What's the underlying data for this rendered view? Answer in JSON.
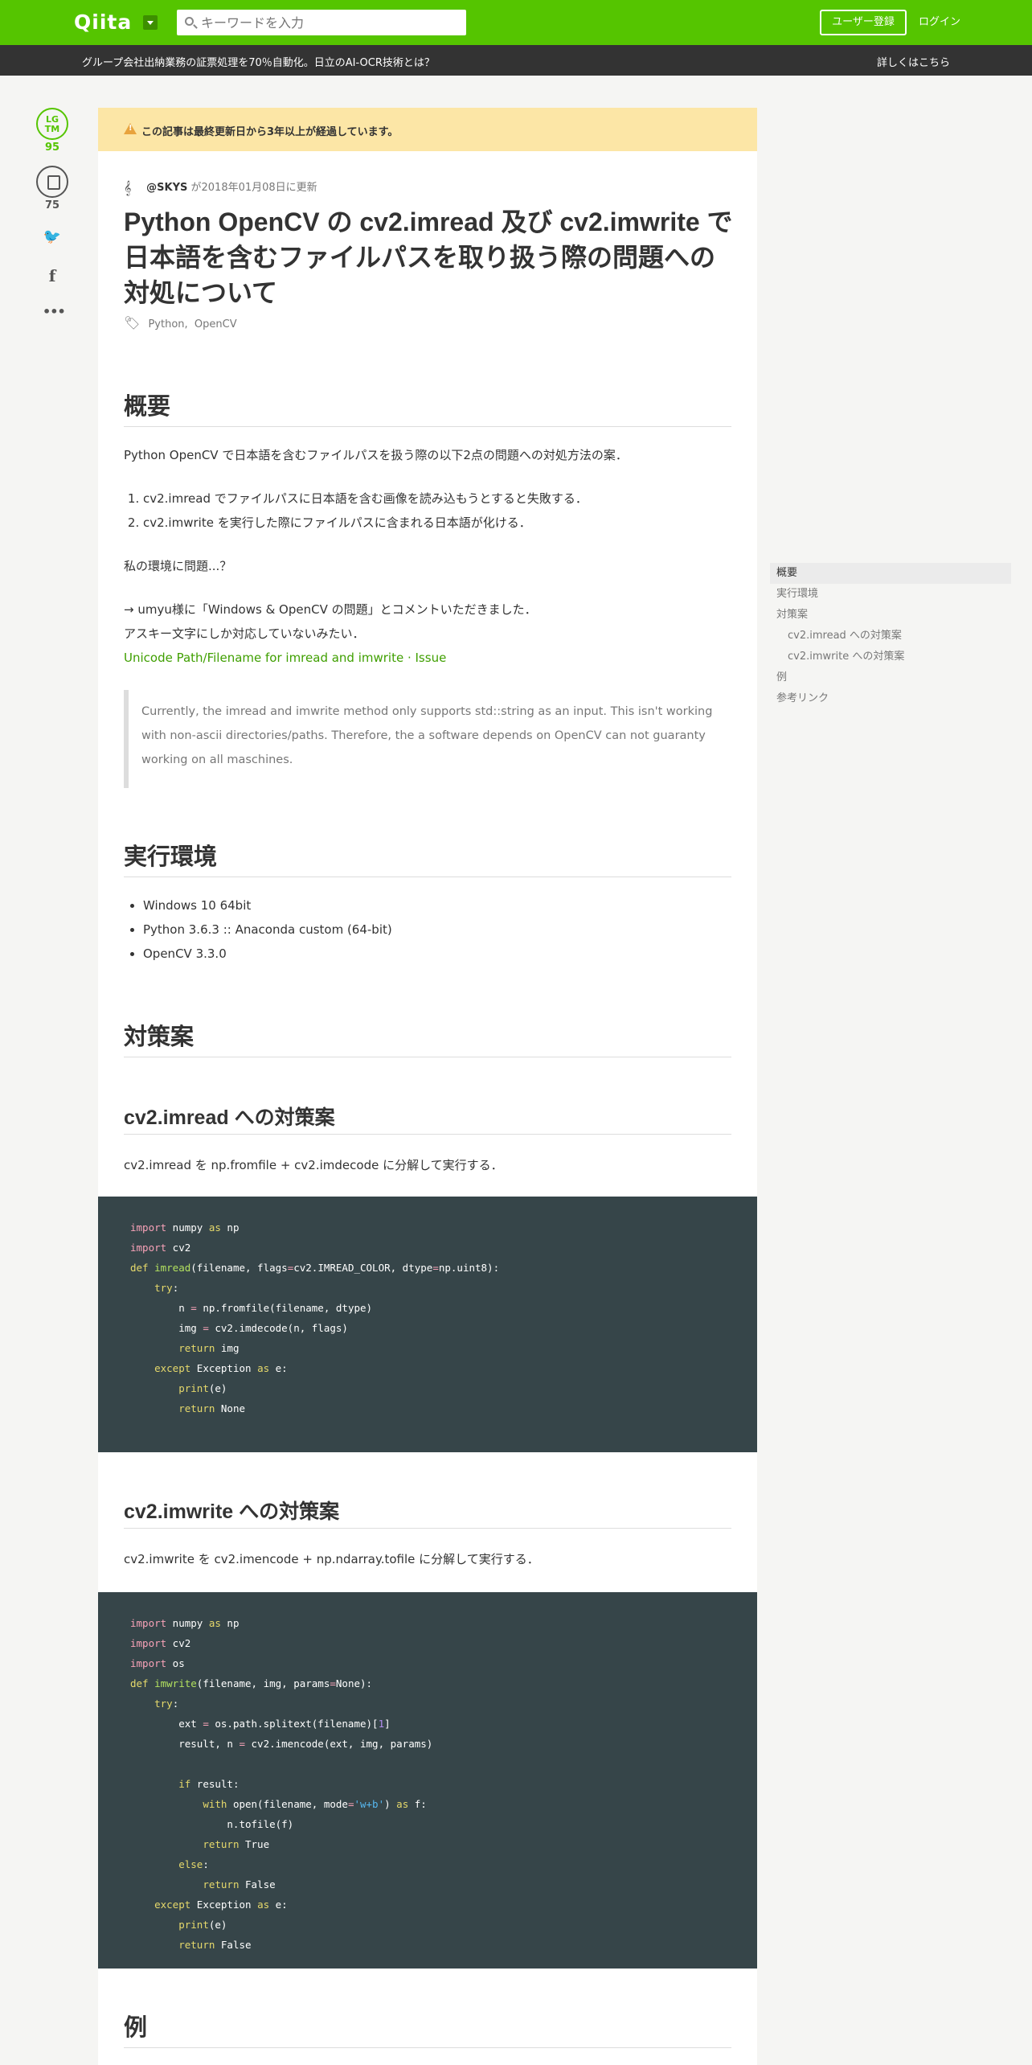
{
  "header": {
    "logo": "Qiita",
    "search_placeholder": "キーワードを入力",
    "signup_label": "ユーザー登録",
    "login_label": "ログイン"
  },
  "adbar": {
    "text": "グループ会社出納業務の証票処理を70％自動化。日立のAI-OCR技術とは？",
    "link": "詳しくはこちら"
  },
  "rail": {
    "lgtm_label_1": "LG",
    "lgtm_label_2": "TM",
    "lgtm_count": "95",
    "stock_count": "75"
  },
  "article": {
    "warning": "この記事は最終更新日から3年以上が経過しています。",
    "author": "@SKYS",
    "updated": "が2018年01月08日に更新",
    "title": "Python OpenCV の cv2.imread 及び cv2.imwrite で日本語を含むファイルパスを取り扱う際の問題への対処について",
    "tags": [
      "Python",
      "OpenCV"
    ],
    "sections": {
      "overview": "概要",
      "env": "実行環境",
      "measures": "対策案",
      "imread": "cv2.imread への対策案",
      "imwrite": "cv2.imwrite への対策案",
      "example": "例"
    },
    "overview_intro": "Python OpenCV で日本語を含むファイルパスを扱う際の以下2点の問題への対処方法の案．",
    "problems": [
      "cv2.imread でファイルパスに日本語を含む画像を読み込もうとすると失敗する．",
      "cv2.imwrite を実行した際にファイルパスに含まれる日本語が化ける．"
    ],
    "question": "私の環境に問題...？",
    "comment_line1": "→ umyu様に「Windows & OpenCV の問題」とコメントいただきました．",
    "comment_line2": "アスキー文字にしか対応していないみたい．",
    "issue_link": "Unicode Path/Filename for imread and imwrite · Issue",
    "quote": "Currently, the imread and imwrite method only supports std::string as an input. This isn't working with non-ascii directories/paths. Therefore, the a software depends on OpenCV can not guaranty working on all maschines.",
    "env_items": [
      "Windows 10 64bit",
      "Python 3.6.3 :: Anaconda custom (64-bit)",
      "OpenCV 3.3.0"
    ],
    "imread_desc": "cv2.imread を np.fromfile + cv2.imdecode に分解して実行する．",
    "imwrite_desc": "cv2.imwrite を cv2.imencode + np.ndarray.tofile に分解して実行する．"
  },
  "toc": [
    {
      "label": "概要",
      "level": 1,
      "active": true
    },
    {
      "label": "実行環境",
      "level": 1,
      "active": false
    },
    {
      "label": "対策案",
      "level": 1,
      "active": false
    },
    {
      "label": "cv2.imread への対策案",
      "level": 2,
      "active": false
    },
    {
      "label": "cv2.imwrite への対策案",
      "level": 2,
      "active": false
    },
    {
      "label": "例",
      "level": 1,
      "active": false
    },
    {
      "label": "参考リンク",
      "level": 1,
      "active": false
    }
  ],
  "colors": {
    "brand": "#55c500",
    "code_bg": "#364549",
    "warning_bg": "#fce6a6"
  }
}
